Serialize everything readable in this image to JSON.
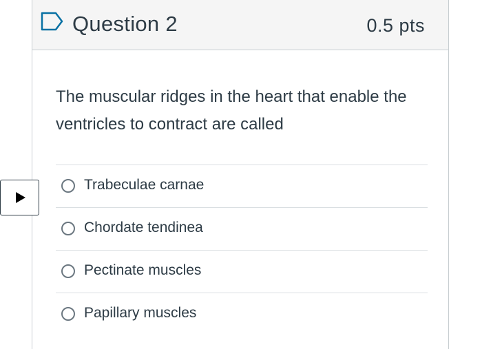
{
  "question": {
    "title": "Question 2",
    "points": "0.5 pts",
    "flag_icon": "bookmark-flag-icon",
    "text": "The muscular ridges in the heart that enable the ventricles to contract are called"
  },
  "answers": [
    {
      "label": "Trabeculae carnae",
      "selected": false
    },
    {
      "label": "Chordate tendinea",
      "selected": false
    },
    {
      "label": "Pectinate muscles",
      "selected": false
    },
    {
      "label": "Papillary muscles",
      "selected": false
    }
  ],
  "side_toggle": {
    "icon": "play-triangle-icon"
  },
  "colors": {
    "text": "#2d3b45",
    "header_bg": "#f5f5f5",
    "flag": "#0770a3",
    "border": "#c7cdd1"
  }
}
